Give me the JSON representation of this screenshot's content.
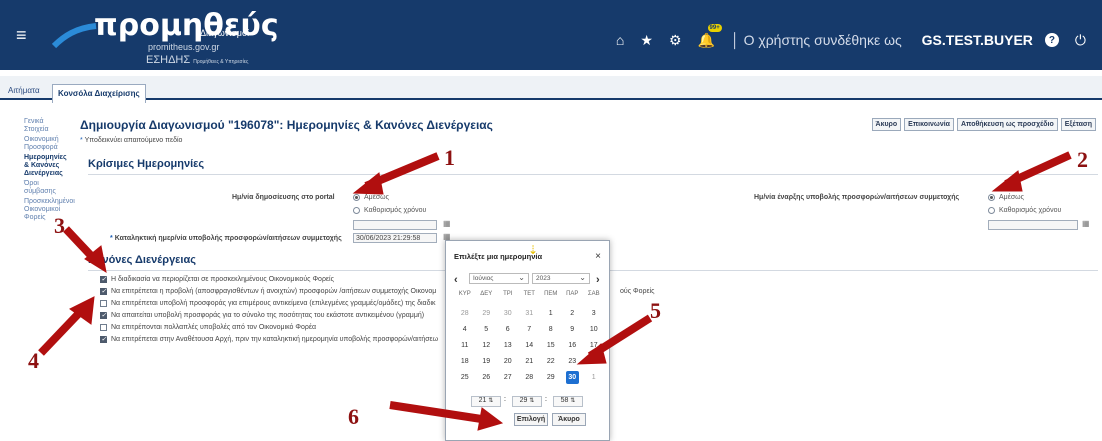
{
  "header": {
    "brand": "προμηθεύς",
    "brand_sub": "Διαγωνισμοί",
    "site": "promitheus.gov.gr",
    "esidis_label": "ΕΣΗΔΗΣ",
    "esidis_small": "Προμήθειες & Υπηρεσίες",
    "notif_count": "99+",
    "user_prefix": "Ο χρήστης συνδέθηκε ως",
    "user_name": "GS.TEST.BUYER"
  },
  "tabs": [
    "Αιτήματα",
    "Κονσόλα Διαχείρισης"
  ],
  "sidebar": [
    "Γενικά Στοιχεία",
    "Οικονομική Προσφορά",
    "Ημερομηνίες & Κανόνες Διενέργειας",
    "Όροι σύμβασης",
    "Προσκεκλημένοι Οικονομικοί Φορείς"
  ],
  "page": {
    "title": "Δημιουργία Διαγωνισμού \"196078\": Ημερομηνίες & Κανόνες Διενέργειας",
    "required_note": "Υποδεικνύει απαιτούμενο πεδίο"
  },
  "toolbar": {
    "cancel": "Άκυρο",
    "communication": "Επικοινωνία",
    "save_draft": "Αποθήκευση ως προσχέδιο",
    "exit": "Εξέταση"
  },
  "critical_dates": {
    "title": "Κρίσιμες Ημερομηνίες",
    "publish_label": "Ημ/νία δημοσίευσης στο portal",
    "publish_now": "Αμέσως",
    "publish_set": "Καθορισμός χρόνου",
    "deadline_label": "Καταληκτική ημερ/νία υποβολής προσφορών/αιτήσεων συμμετοχής",
    "deadline_value": "30/06/2023 21:29:58",
    "start_label": "Ημ/νία έναρξης υποβολής προσφορών/αιτήσεων συμμετοχής",
    "start_now": "Αμέσως",
    "start_set": "Καθορισμός χρόνου"
  },
  "rules": {
    "title": "Κανόνες Διενέργειας",
    "items": [
      {
        "text": "Η διαδικασία να περιορίζεται σε προσκεκλημένους Οικονομικούς Φορείς",
        "checked": true
      },
      {
        "text": "Να επιτρέπεται η προβολή (αποσφραγισθέντων ή ανοιχτών) προσφορών /αιτήσεων συμμετοχής Οικονομ",
        "checked": true
      },
      {
        "text": "Να επιτρέπεται υποβολή προσφοράς για επιμέρους αντικείμενα (επιλεγμένες γραμμές/ομάδες) της διαδικ",
        "checked": false
      },
      {
        "text": "Να απαιτείται υποβολή προσφοράς για το σύνολο της ποσότητας του εκάστοτε αντικειμένου (γραμμή)",
        "checked": true
      },
      {
        "text": "Να επιτρέπονται πολλαπλές υποβολές από τον Οικονομικό Φορέα",
        "checked": false
      },
      {
        "text": "Να επιτρέπεται στην Αναθέτουσα Αρχή, πριν την καταληκτική ημερομηνία υποβολής προσφορών/αιτήσεω",
        "checked": true
      }
    ],
    "overflow_text": "ούς Φορείς"
  },
  "datepicker": {
    "title": "Επιλέξτε μια ημερομηνία",
    "month": "Ιούνιος",
    "year": "2023",
    "day_names": [
      "ΚΥΡ",
      "ΔΕΥ",
      "ΤΡΙ",
      "ΤΕΤ",
      "ΠΕΜ",
      "ΠΑΡ",
      "ΣΑΒ"
    ],
    "weeks": [
      [
        "28",
        "29",
        "30",
        "31",
        "1",
        "2",
        "3"
      ],
      [
        "4",
        "5",
        "6",
        "7",
        "8",
        "9",
        "10"
      ],
      [
        "11",
        "12",
        "13",
        "14",
        "15",
        "16",
        "17"
      ],
      [
        "18",
        "19",
        "20",
        "21",
        "22",
        "23",
        "24"
      ],
      [
        "25",
        "26",
        "27",
        "28",
        "29",
        "30",
        "1"
      ]
    ],
    "selected_day": "30",
    "hour": "21",
    "minute": "29",
    "second": "58",
    "ok": "Επιλογή",
    "cancel": "Άκυρο"
  },
  "callouts": [
    "1",
    "2",
    "3",
    "4",
    "5",
    "6"
  ],
  "colors": {
    "header_bg": "#163a6b",
    "accent_blue": "#1d6fd1",
    "callout_red": "#8d1111"
  },
  "icons": [
    "hamburger-icon",
    "home-icon",
    "star-icon",
    "gear-icon",
    "bell-icon",
    "help-icon",
    "power-icon",
    "calendar-icon"
  ]
}
